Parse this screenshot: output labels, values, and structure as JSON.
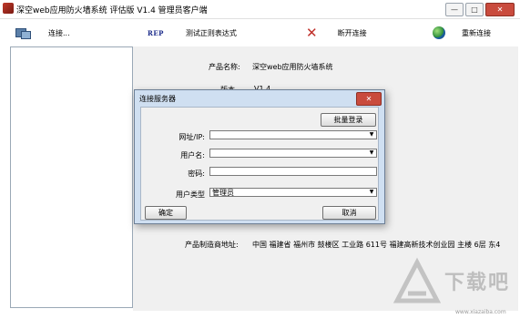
{
  "window": {
    "title": "深空web应用防火墙系统 评估版 V1.4 管理员客户端",
    "controls": [
      "—",
      "□",
      "✕"
    ]
  },
  "toolbar": {
    "connect_label": "连接...",
    "regex_icon_text": "REP",
    "regex_label": "测试正则表达式",
    "disconnect_label": "断开连接",
    "reconnect_label": "重新连接"
  },
  "info": {
    "product_name_label": "产品名称:",
    "product_name_value": "深空web应用防火墙系统",
    "version_label_partial": "版本",
    "version_value_partial": "V1.4",
    "address_label": "产品制造商地址:",
    "address_value": "中国 福建省 福州市 鼓楼区 工业路 611号 福建高新技术创业园 主楼 6层 东4"
  },
  "dialog": {
    "title": "连接服务器",
    "close_glyph": "✕",
    "batch_login_label": "批量登录",
    "url_label": "网址/IP:",
    "url_value": "",
    "username_label": "用户名:",
    "username_value": "",
    "password_label": "密码:",
    "password_value": "",
    "usertype_label": "用户类型",
    "usertype_value": "管理员",
    "ok_label": "确定",
    "cancel_label": "取消"
  },
  "watermark": {
    "text": "下载吧",
    "url": "www.xiazaiba.com"
  }
}
